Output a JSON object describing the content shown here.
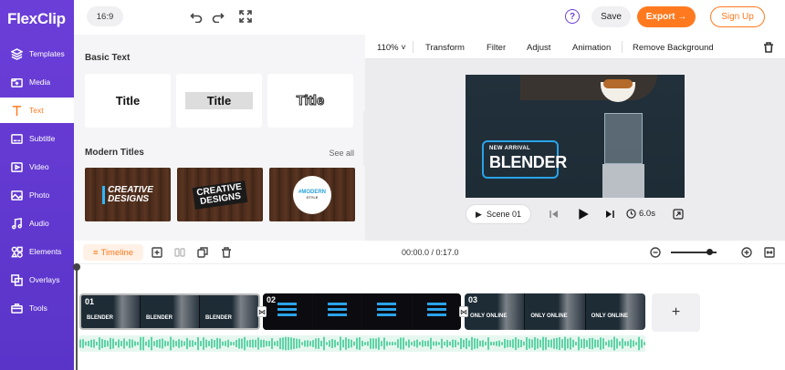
{
  "app": {
    "logo": "FlexClip"
  },
  "sidebar": {
    "items": [
      {
        "label": "Templates",
        "icon": "layers-icon"
      },
      {
        "label": "Media",
        "icon": "media-icon"
      },
      {
        "label": "Text",
        "icon": "text-icon",
        "active": true
      },
      {
        "label": "Subtitle",
        "icon": "subtitle-icon"
      },
      {
        "label": "Video",
        "icon": "video-icon"
      },
      {
        "label": "Photo",
        "icon": "photo-icon"
      },
      {
        "label": "Audio",
        "icon": "audio-icon"
      },
      {
        "label": "Elements",
        "icon": "elements-icon"
      },
      {
        "label": "Overlays",
        "icon": "overlays-icon"
      },
      {
        "label": "Tools",
        "icon": "tools-icon"
      }
    ]
  },
  "topbar": {
    "ratio": "16:9",
    "help": "?",
    "save": "Save",
    "export": "Export →",
    "signup": "Sign Up"
  },
  "panel": {
    "basic_text_title": "Basic Text",
    "basic_cards": [
      "Title",
      "Title",
      "Title"
    ],
    "modern_titles_title": "Modern Titles",
    "see_all": "See all",
    "templates": [
      {
        "line1": "CREATIVE",
        "line2": "DESIGNS"
      },
      {
        "line1": "CREATIVE",
        "line2": "DESIGNS"
      },
      {
        "line1": "#MODERN",
        "line2": "STYLE"
      }
    ]
  },
  "preview_toolbar": {
    "zoom": "110%",
    "items": [
      "Transform",
      "Filter",
      "Adjust",
      "Animation",
      "Remove Background"
    ]
  },
  "video": {
    "tag": "NEW ARRIVAL",
    "title": "BLENDER"
  },
  "controls": {
    "scene": "Scene 01",
    "duration": "6.0s"
  },
  "timeline": {
    "label": "Timeline",
    "time": "00:00.0 / 0:17.0",
    "zoom_level": 0.85,
    "clips": [
      {
        "num": "01",
        "caption": "BLENDER"
      },
      {
        "num": "02",
        "caption": ""
      },
      {
        "num": "03",
        "caption": "ONLY ONLINE"
      }
    ],
    "add": "+"
  },
  "colors": {
    "brand": "#6b3ed8",
    "accent": "#ff7a1f",
    "audio": "#5fd3a6"
  }
}
